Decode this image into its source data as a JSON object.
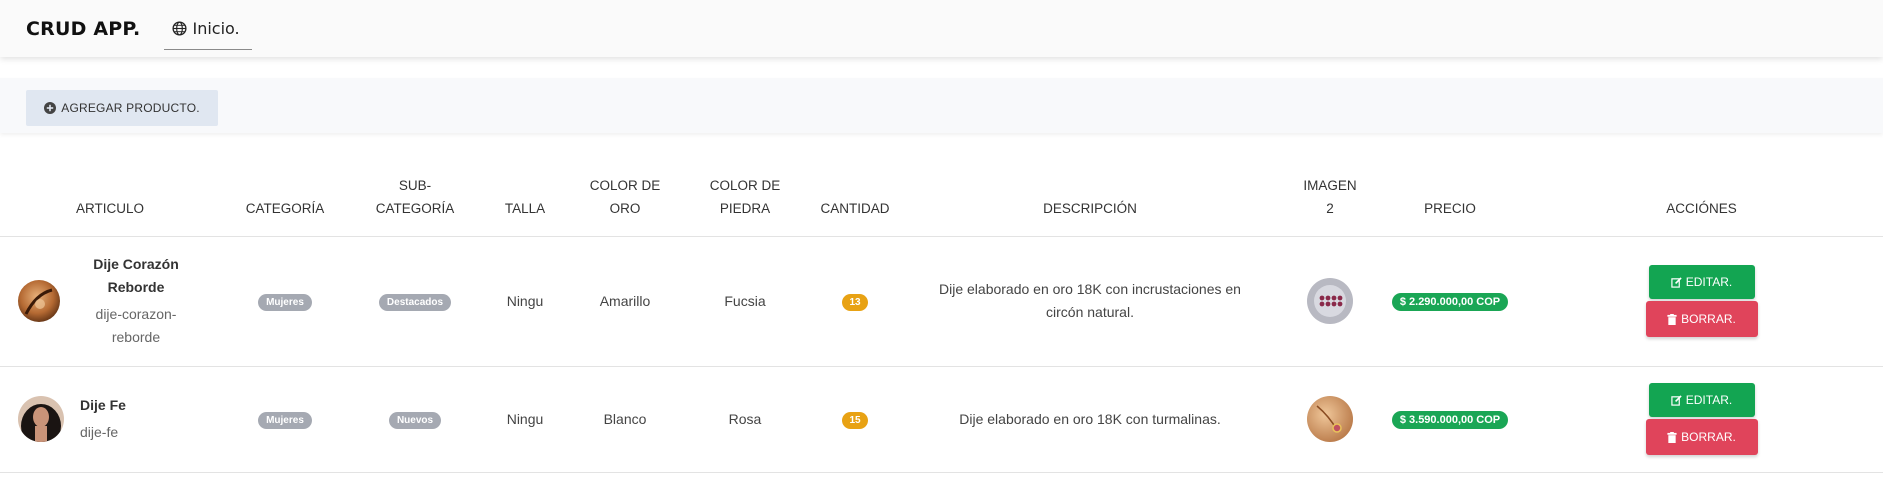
{
  "navbar": {
    "brand": "CRUD APP.",
    "home_link": "Inicio."
  },
  "toolbar": {
    "add_label": "AGREGAR PRODUCTO."
  },
  "table": {
    "headers": {
      "articulo": "ARTICULO",
      "categoria": "CATEGORÍA",
      "subcategoria_1": "SUB-",
      "subcategoria_2": "CATEGORÍA",
      "talla": "TALLA",
      "color_oro_1": "COLOR DE",
      "color_oro_2": "ORO",
      "color_piedra_1": "COLOR DE",
      "color_piedra_2": "PIEDRA",
      "cantidad": "CANTIDAD",
      "descripcion": "DESCRIPCIÓN",
      "imagen_1": "IMAGEN",
      "imagen_2": "2",
      "precio": "PRECIO",
      "acciones": "ACCIÓNES"
    },
    "rows": [
      {
        "name_1": "Dije Corazón",
        "name_2": "Reborde",
        "slug_1": "dije-corazon-",
        "slug_2": "reborde",
        "categoria": "Mujeres",
        "subcategoria": "Destacados",
        "talla": "Ningu",
        "color_oro": "Amarillo",
        "color_piedra": "Fucsia",
        "cantidad": "13",
        "descripcion_1": "Dije elaborado en oro 18K con incrustaciones en",
        "descripcion_2": "circón natural.",
        "precio": "$ 2.290.000,00 COP",
        "edit_label": "EDITAR.",
        "delete_label": "BORRAR."
      },
      {
        "name_1": "Dije Fe",
        "slug_1": "dije-fe",
        "categoria": "Mujeres",
        "subcategoria": "Nuevos",
        "talla": "Ningu",
        "color_oro": "Blanco",
        "color_piedra": "Rosa",
        "cantidad": "15",
        "descripcion_1": "Dije elaborado en oro 18K con turmalinas.",
        "precio": "$ 3.590.000,00 COP",
        "edit_label": "EDITAR.",
        "delete_label": "BORRAR."
      }
    ]
  },
  "colors": {
    "edit": "#13a552",
    "delete": "#e0445b",
    "price_badge": "#1aa655",
    "qty_badge": "#e8a214",
    "category_badge": "#a5a9b2"
  }
}
